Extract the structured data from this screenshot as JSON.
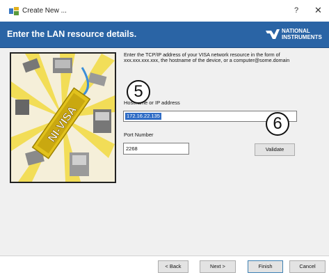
{
  "window": {
    "title": "Create New ...",
    "help_glyph": "?",
    "close_glyph": "✕"
  },
  "banner": {
    "heading": "Enter the LAN resource details.",
    "logo_line1": "NATIONAL",
    "logo_line2": "INSTRUMENTS"
  },
  "illustration": {
    "text": "NI-VISA"
  },
  "form": {
    "description": "Enter the TCP/IP address of your VISA network resource in the form of xxx.xxx.xxx.xxx, the hostname of the device, or a computer@some.domain",
    "address_label": "Hostname or IP address",
    "address_value": "172.16.22.135",
    "port_label": "Port Number",
    "port_value": "2268",
    "validate_label": "Validate"
  },
  "callouts": {
    "step5": "5",
    "step6": "6"
  },
  "footer": {
    "back_label": "< Back",
    "next_label": "Next >",
    "finish_label": "Finish",
    "cancel_label": "Cancel"
  },
  "colors": {
    "banner": "#2a64a5",
    "selection": "#2f6cc5",
    "illustration_bar": "#e2c21c"
  }
}
